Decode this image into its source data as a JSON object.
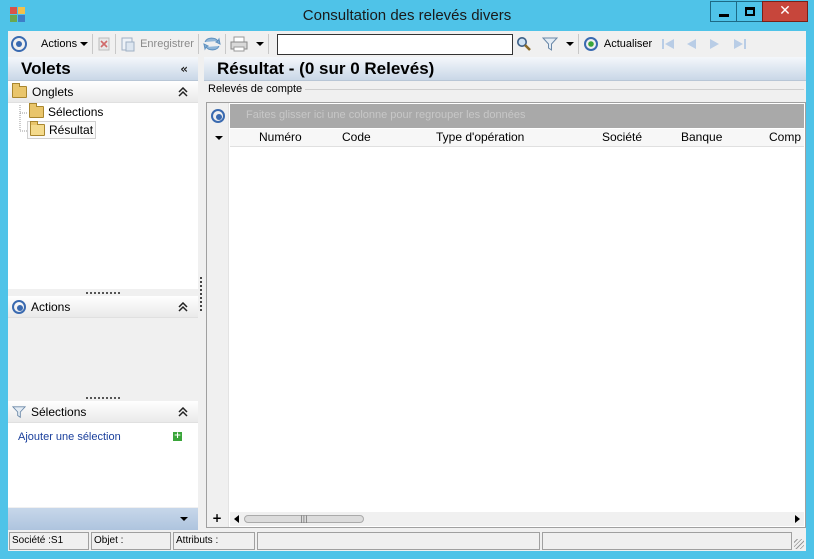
{
  "window": {
    "title": "Consultation des relevés divers",
    "minimize_glyph": "",
    "close_glyph": "✕"
  },
  "toolbar": {
    "actions_label": "Actions",
    "save_label": "Enregistrer",
    "search_value": "",
    "refresh_label": "Actualiser"
  },
  "left_pane": {
    "title": "Volets",
    "collapse_glyph": "«",
    "onglets": {
      "label": "Onglets",
      "items": [
        {
          "label": "Sélections"
        },
        {
          "label": "Résultat"
        }
      ]
    },
    "actions": {
      "label": "Actions"
    },
    "selections": {
      "label": "Sélections",
      "add_link": "Ajouter une sélection"
    }
  },
  "right_pane": {
    "title": "Résultat - (0 sur 0 Relevés)",
    "group_title": "Relevés de compte",
    "group_panel_hint": "Faites glisser ici une colonne pour regrouper les données",
    "columns": [
      "Numéro",
      "Code",
      "Type d'opération",
      "Société",
      "Banque",
      "Comp"
    ]
  },
  "statusbar": {
    "societe": "Société :S1",
    "objet": "Objet :",
    "attributs": "Attributs :"
  },
  "colors": {
    "frame": "#4fc3e8",
    "close": "#c7463b",
    "header_gradient_end": "#c9d7e7",
    "accent_blue": "#3a6ab0"
  }
}
